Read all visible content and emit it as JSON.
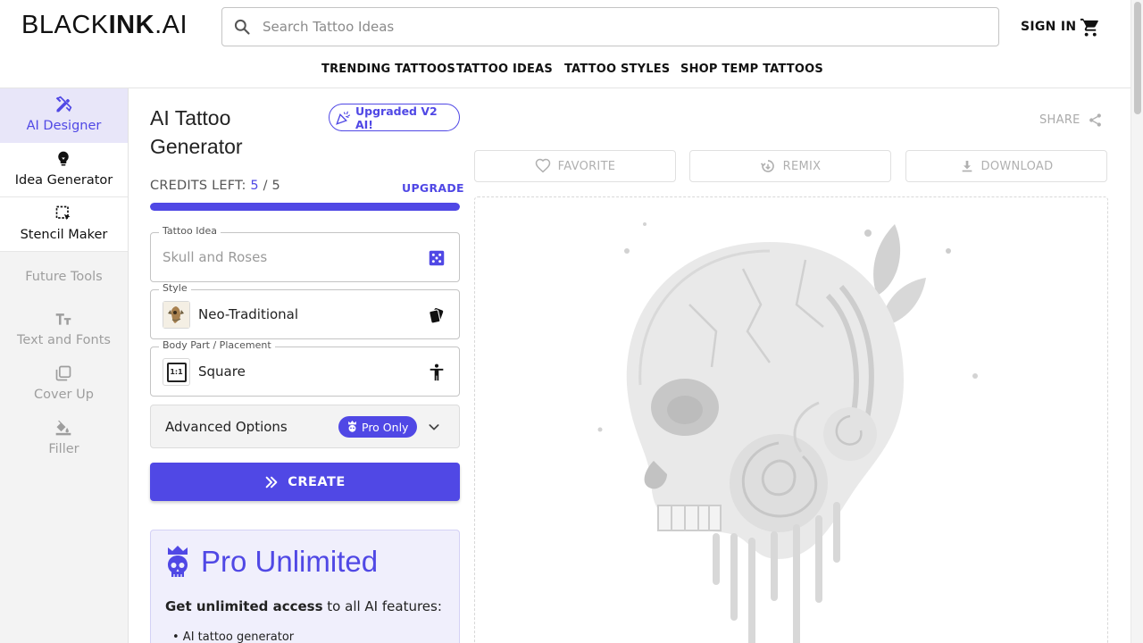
{
  "header": {
    "logo_part1": "BLACK",
    "logo_part2": "INK",
    "logo_part3": ".AI",
    "search_placeholder": "Search Tattoo Ideas",
    "sign_in": "SIGN IN",
    "icons": {
      "search": "search-icon",
      "cart": "cart-icon"
    }
  },
  "topnav": {
    "items": [
      "TRENDING TATTOOS",
      "TATTOO IDEAS",
      "TATTOO STYLES",
      "SHOP TEMP TATTOOS"
    ]
  },
  "sidebar": {
    "items": [
      {
        "label": "AI Designer",
        "icon": "pen-ruler-icon",
        "state": "active"
      },
      {
        "label": "Idea Generator",
        "icon": "lightbulb-icon",
        "state": "enabled"
      },
      {
        "label": "Stencil Maker",
        "icon": "stencil-select-icon",
        "state": "enabled"
      }
    ],
    "future_label": "Future Tools",
    "future_items": [
      {
        "label": "Text and Fonts",
        "icon": "text-icon"
      },
      {
        "label": "Cover Up",
        "icon": "layers-icon"
      },
      {
        "label": "Filler",
        "icon": "paint-bucket-icon"
      }
    ]
  },
  "generator": {
    "title": "AI Tattoo Generator",
    "v2_badge": "Upgraded V2 AI!",
    "credits_label": "CREDITS LEFT:",
    "credits_used": "5",
    "credits_sep": "/",
    "credits_total": "5",
    "credits_fraction": 1.0,
    "upgrade": "UPGRADE",
    "idea": {
      "label": "Tattoo Idea",
      "placeholder": "Skull and Roses",
      "icon": "dice-icon"
    },
    "style": {
      "label": "Style",
      "value": "Neo-Traditional",
      "icon": "cards-icon"
    },
    "placement": {
      "label": "Body Part / Placement",
      "value": "Square",
      "thumb_text": "1:1",
      "icon": "person-icon"
    },
    "advanced": {
      "label": "Advanced Options",
      "badge": "Pro Only"
    },
    "create": "CREATE"
  },
  "pro_card": {
    "title": "Pro Unlimited",
    "text_bold": "Get unlimited access",
    "text_rest": " to all AI features:",
    "list_item": "• AI tattoo generator"
  },
  "preview": {
    "share": "SHARE",
    "favorite": "FAVORITE",
    "remix": "REMIX",
    "download": "DOWNLOAD"
  },
  "colors": {
    "accent": "#5048e5",
    "accent_light": "#e8e6f9",
    "muted": "#9e9e9e"
  }
}
